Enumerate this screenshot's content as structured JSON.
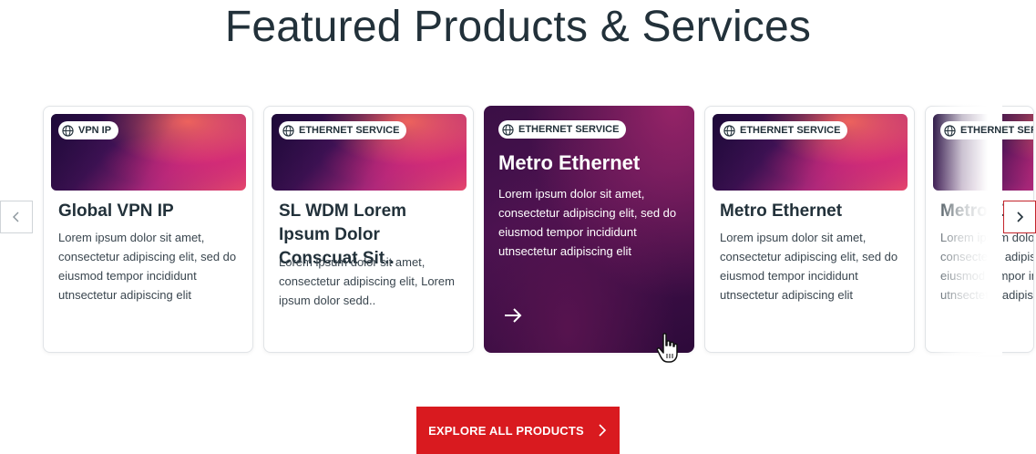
{
  "section": {
    "title": "Featured Products & Services"
  },
  "carousel": {
    "prev_icon": "chevron-left-icon",
    "next_icon": "chevron-right-icon",
    "cards": [
      {
        "badge": "VPN IP",
        "title": "Global VPN IP",
        "description": "Lorem ipsum dolor sit amet, consectetur adipiscing elit, sed do eiusmod tempor incididunt utnsectetur adipiscing elit"
      },
      {
        "badge": "ETHERNET SERVICE",
        "title": "SL WDM Lorem Ipsum Dolor Conscuat Sit..",
        "description": "Lorem ipsum dolor sit amet, consectetur adipiscing elit, Lorem ipsum dolor sedd.."
      },
      {
        "badge": "ETHERNET SERVICE",
        "title": "Metro Ethernet",
        "description": "Lorem ipsum dolor sit amet, consectetur adipiscing elit, sed do eiusmod tempor incididunt utnsectetur adipiscing elit"
      },
      {
        "badge": "ETHERNET SERVICE",
        "title": "Metro Ethernet",
        "description": "Lorem ipsum dolor sit amet, consectetur adipiscing elit, sed do eiusmod tempor incididunt utnsectetur adipiscing elit"
      },
      {
        "badge": "ETHERNET SERVICE",
        "title": "Metro Ethernet",
        "description": "Lorem ipsum dolor sit amet, consectetur adipiscing elit, sed do eiusmod tempor incididunt utnsectetur adipiscing elit"
      }
    ]
  },
  "explore": {
    "label": "EXPLORE ALL PRODUCTS"
  },
  "colors": {
    "accent": "#d91a1f",
    "text": "#22313a",
    "active_card_bg": "#3a0f45"
  }
}
